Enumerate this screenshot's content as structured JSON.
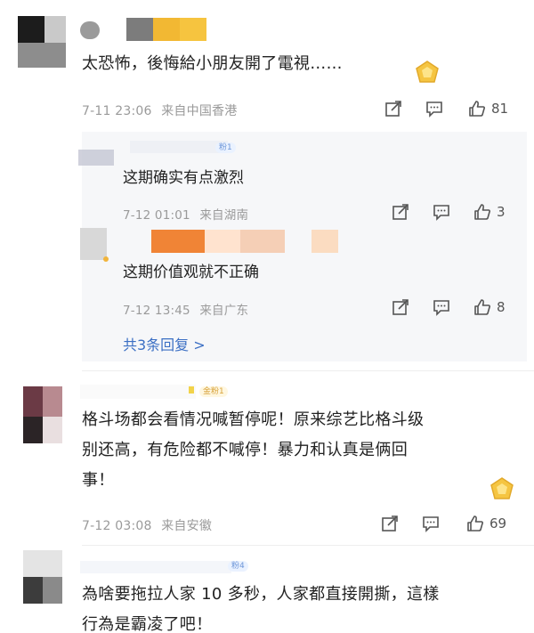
{
  "comments": [
    {
      "text": "太恐怖，後悔給小朋友開了電視……",
      "time": "7-11 23:06",
      "location": "来自中国香港",
      "likes": "81"
    },
    {
      "badge": "金粉1",
      "text_line1": "格斗场都会看情况喊暂停呢！原来综艺比格斗级",
      "text_line2": "别还高，有危险都不喊停！暴力和认真是俩回",
      "text_line3": "事！",
      "time": "7-12 03:08",
      "location": "来自安徽",
      "likes": "69"
    },
    {
      "badge": "粉4",
      "text_line1": "為啥要拖拉人家 10 多秒，人家都直接開撕，這樣",
      "text_line2": "行為是霸凌了吧！"
    }
  ],
  "replies": [
    {
      "badge": "粉1",
      "text": "这期确实有点激烈",
      "time": "7-12 01:01",
      "location": "来自湖南",
      "likes": "3"
    },
    {
      "text": "这期价值观就不正确",
      "time": "7-12 13:45",
      "location": "来自广东",
      "likes": "8"
    }
  ],
  "more_replies_label": "共3条回复 >",
  "colors": {
    "link": "#3b6fc4",
    "meta": "#9a9a9a",
    "badge": "#d8a23a"
  },
  "icons": [
    "share-icon",
    "comment-icon",
    "like-icon",
    "gold-badge-icon"
  ]
}
